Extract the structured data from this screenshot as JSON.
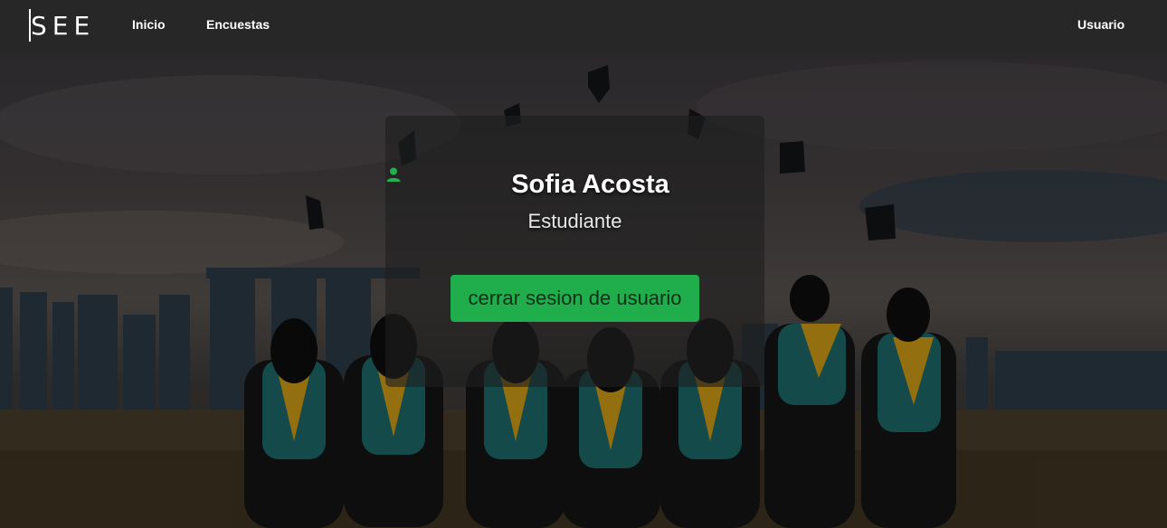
{
  "navbar": {
    "brand": "SEE",
    "links": [
      "Inicio",
      "Encuestas"
    ],
    "user_link": "Usuario"
  },
  "hero": {
    "background_scene": "graduation-photo"
  },
  "profile": {
    "icon": "user-icon",
    "name": "Sofia Acosta",
    "role": "Estudiante",
    "logout_label": "cerrar sesion de usuario"
  },
  "colors": {
    "navbar_bg": "#272727",
    "button_bg": "#1fae4b",
    "icon_green": "#22b14c"
  }
}
